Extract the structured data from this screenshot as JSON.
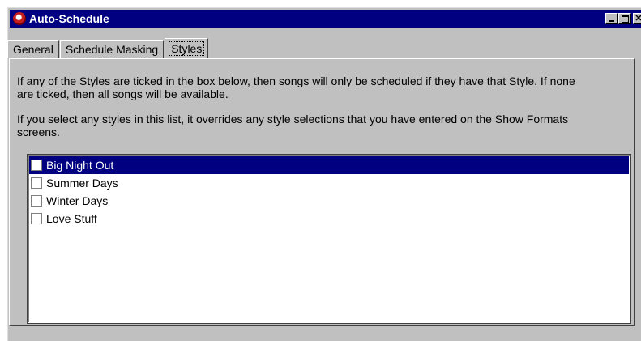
{
  "window": {
    "title": "Auto-Schedule",
    "close_glyph": "✕"
  },
  "tabs": [
    {
      "label": "General",
      "active": false
    },
    {
      "label": "Schedule Masking",
      "active": false
    },
    {
      "label": "Styles",
      "active": true
    }
  ],
  "styles_panel": {
    "description_1": "If any of the Styles are ticked in the box below, then songs will only be scheduled if they have that Style. If none are ticked, then all songs will be available.",
    "description_2": "If you select any styles in this list, it overrides any style selections that you have entered on the Show Formats screens.",
    "styles": [
      {
        "label": "Big Night Out",
        "checked": false,
        "selected": true
      },
      {
        "label": "Summer Days",
        "checked": false,
        "selected": false
      },
      {
        "label": "Winter Days",
        "checked": false,
        "selected": false
      },
      {
        "label": "Love Stuff",
        "checked": false,
        "selected": false
      }
    ]
  },
  "colors": {
    "titlebar": "#000080",
    "face": "#c0c0c0",
    "selection": "#000080"
  }
}
